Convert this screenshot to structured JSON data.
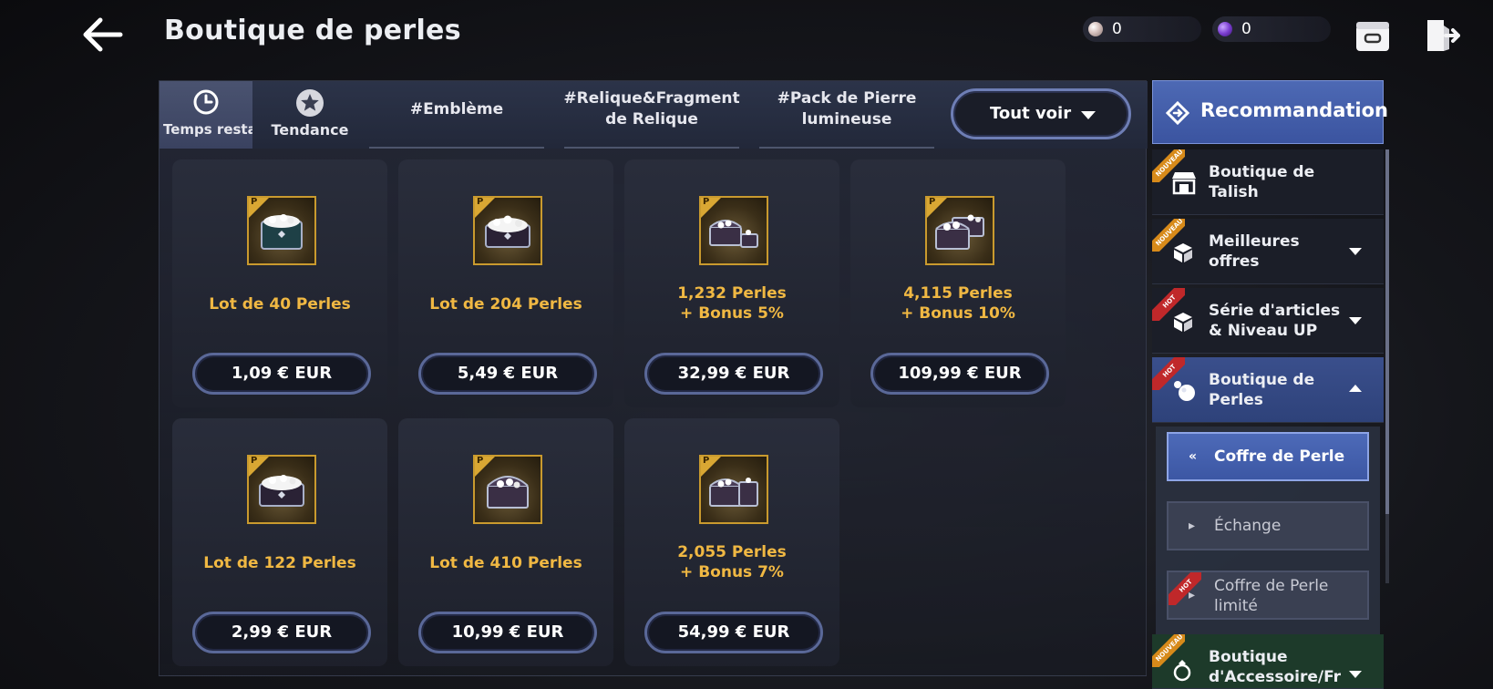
{
  "header": {
    "title": "Boutique de perles",
    "currencies": [
      {
        "name": "pearl",
        "value": "0"
      },
      {
        "name": "gem",
        "value": "0"
      }
    ]
  },
  "tabs": [
    {
      "label": "Temps resta",
      "icon": "clock-icon"
    },
    {
      "label": "Tendance",
      "icon": "star-icon"
    },
    {
      "label": "#Emblème"
    },
    {
      "label": "#Relique&Fragment de Relique"
    },
    {
      "label": "#Pack de Pierre lumineuse"
    }
  ],
  "see_all": {
    "label": "Tout voir"
  },
  "products": [
    {
      "name": "Lot de 40 Perles",
      "price": "1,09 € EUR"
    },
    {
      "name": "Lot de 204 Perles",
      "price": "5,49 € EUR"
    },
    {
      "name": "1,232 Perles\n+ Bonus 5%",
      "price": "32,99 € EUR"
    },
    {
      "name": "4,115 Perles\n+ Bonus 10%",
      "price": "109,99 € EUR"
    },
    {
      "name": "Lot de 122 Perles",
      "price": "2,99 € EUR"
    },
    {
      "name": "Lot de 410 Perles",
      "price": "10,99 € EUR"
    },
    {
      "name": "2,055 Perles\n+ Bonus 7%",
      "price": "54,99 € EUR"
    }
  ],
  "product_badge_letter": "P",
  "sidebar": {
    "recommend_label": "Recommandation",
    "items": [
      {
        "label": "Boutique de Talish",
        "ribbon": "NOUVEAU"
      },
      {
        "label": "Meilleures offres",
        "ribbon": "NOUVEAU"
      },
      {
        "label": "Série d'articles & Niveau UP",
        "ribbon": "HOT"
      },
      {
        "label": "Boutique de Perles",
        "ribbon": "HOT"
      },
      {
        "label": "Boutique d'Accessoire/Fr",
        "ribbon": "NOUVEAU"
      }
    ],
    "sub_items": [
      {
        "label": "Coffre de Perle",
        "active": true
      },
      {
        "label": "Échange",
        "active": false
      },
      {
        "label": "Coffre de Perle limité",
        "ribbon": "HOT",
        "active": false
      }
    ]
  },
  "colors": {
    "accent_blue": "#3b54a0",
    "product_name_gold": "#f0b843",
    "ribbon_new": "#d78a1a",
    "ribbon_hot": "#c0282a"
  }
}
